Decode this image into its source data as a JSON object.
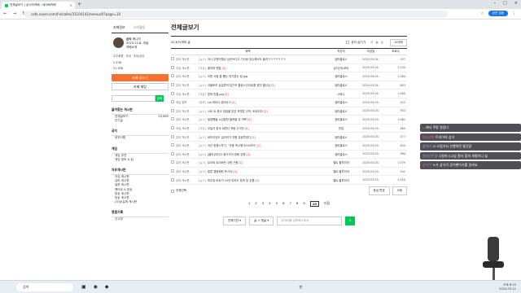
{
  "browser": {
    "tab_title": "전체글보기 | 삼식이카페 : 네이버카페",
    "url": "cafe.naver.com/f-e/cafes/31104141/menus/0?page=10",
    "profile_label": "완전 접음"
  },
  "sidebar": {
    "tabs": [
      "카페정보",
      "나의활동"
    ],
    "cafe_name": "삼식",
    "cafe_sub": "매니저",
    "since": "2023.12.8. 개설",
    "invite": "카페소개",
    "links": [
      "우수회원",
      "초대",
      "초대/공유"
    ],
    "stats": [
      "2,438",
      "51,638"
    ],
    "write_button": "카페 글쓰기",
    "join_button": "카페 채팅",
    "search_button": "검색",
    "sections": [
      {
        "title": "즐겨찾는 게시판",
        "items": [
          {
            "label": "전체글보기",
            "count": "20,869"
          },
          {
            "label": "인기글",
            "count": ""
          }
        ]
      },
      {
        "title": "공지",
        "items": [
          {
            "label": "공지사항",
            "count": ""
          }
        ]
      },
      {
        "title": "게임",
        "items": [
          {
            "label": "게임 추천",
            "count": ""
          },
          {
            "label": "게임 정보 & 팁",
            "count": ""
          }
        ]
      },
      {
        "title": "자유게시판",
        "items": [
          {
            "label": "자유 게시판",
            "count": ""
          },
          {
            "label": "유머 게시판",
            "count": ""
          },
          {
            "label": "질문 게시판",
            "count": ""
          },
          {
            "label": "팬아트 & 방송",
            "count": ""
          },
          {
            "label": "방송 게시판",
            "count": ""
          },
          {
            "label": "방송 게시판",
            "count": ""
          },
          {
            "label": "(오삼)길게 게시판",
            "count": ""
          }
        ]
      },
      {
        "title": "랭겜기록",
        "items": [
          {
            "label": "신고방",
            "count": ""
          }
        ]
      }
    ]
  },
  "main": {
    "title": "전체글보기",
    "count": "20,675개의 글",
    "notice_hide": "공지 숨기기",
    "per_page": "15개씩",
    "headers": [
      "제목",
      "작성자",
      "작성일",
      "조회수"
    ],
    "rows": [
      {
        "cat": "쥬아 게시판",
        "prefix": "[뉴스]",
        "title": "아니 뚜렌이형님 삼큰쓰디고 기사랑 장수해서도 올려ㅋㅋㅋㅋㅋㅋㅋ",
        "comments": "",
        "author": "엄마클로스",
        "date": "2025.03.04.",
        "views": "557"
      },
      {
        "cat": "자유 게시판",
        "prefix": "[자유]",
        "title": "배치파 맨탈",
        "comments": "[2]",
        "author": "남지인트포터",
        "date": "2025.03.04.",
        "views": "2,234"
      },
      {
        "cat": "쥬아 게시판",
        "prefix": "[뉴스]",
        "title": "어떤 사람 좀 뽑는 여기겠는 링.jpg",
        "comments": "",
        "author": "엄마클로스",
        "date": "2025.03.04.",
        "views": "1,084"
      },
      {
        "cat": "쥬아 게시판",
        "prefix": "[뉴스]",
        "title": "괴물토리 삼분류의 당근커 힐링스킨리트를 정민 출신님",
        "comments": "[2]",
        "author": "엄마클로스",
        "date": "2025.03.04.",
        "views": "843"
      },
      {
        "cat": "자유 게시판",
        "prefix": "[자유]",
        "title": "방파 만통.jpg",
        "comments": "[2]",
        "author": "너와나",
        "date": "2025.03.04.",
        "views": "1,060"
      },
      {
        "cat": "게임 정보",
        "prefix": "[정보]",
        "title": "Lol 럭터너 끊어라고",
        "comments": "[2]",
        "author": "엄마클로스",
        "date": "2025.03.03.",
        "views": "422"
      },
      {
        "cat": "쥬아 게시판",
        "prefix": "[뉴스]",
        "title": "사르 트 휴교 밍컴을 받은 포맷픈 신작, 토르티아",
        "comments": "[2]",
        "author": "엄마클로스",
        "date": "2025.03.03.",
        "views": "553"
      },
      {
        "cat": "쥬아 게시판",
        "prefix": "[뉴스]",
        "title": "밀재했을 소심찾한 블렛을 것 격복",
        "comments": "[3]",
        "author": "엄마클로스",
        "date": "2025.03.03.",
        "views": "1,081"
      },
      {
        "cat": "자유 게시판",
        "prefix": "[자유]",
        "title": "오늘자 한국 재판난 격동 주석안",
        "comments": "[4]",
        "author": "빈집",
        "date": "2025.03.03.",
        "views": "680"
      },
      {
        "cat": "쥬아 게시판",
        "prefix": "[뉴스]",
        "title": "바초이당도 길리커가 차원 유링투졌다",
        "comments": "[1]",
        "author": "엄마클로스",
        "date": "2025.03.03.",
        "views": "477"
      },
      {
        "cat": "쥬아 게시판",
        "prefix": "[뉴스]",
        "title": "국산 한좋스투기, \"국좋 즉시행 50%모자\"",
        "comments": "[2]",
        "author": "엄마클로스",
        "date": "2025.03.03.",
        "views": "624"
      },
      {
        "cat": "쥬아 게시판",
        "prefix": "[뉴스]",
        "title": "[블라]라디다 중고지어 대회 성명",
        "comments": "[2]",
        "author": "엄마클로스",
        "date": "2025.03.03.",
        "views": "964"
      },
      {
        "cat": "쥬아 게시판",
        "prefix": "[뉴스]",
        "title": "트리외 트리바린 쿠팡 근원",
        "comments": "[1]",
        "author": "엘트 블루리아",
        "date": "2025.03.03.",
        "views": "1,079"
      },
      {
        "cat": "쥬아 게시판",
        "prefix": "[뉴스]",
        "title": "얼른 캠핑패류 포스터",
        "comments": "[2]",
        "author": "엘트 블루리아",
        "date": "2025.03.03.",
        "views": "441"
      },
      {
        "cat": "쥬아 게시판",
        "prefix": "[뉴스]",
        "title": "퍼주워 바트가 10년 미하도 힘게 된 흐름",
        "comments": "[2]",
        "author": "엘트 블루리아",
        "date": "2025.03.03.",
        "views": "1,020"
      }
    ],
    "select_all": "전체선택",
    "btn_move": "등급 변경",
    "btn_delete": "삭제",
    "pages": [
      "1",
      "2",
      "3",
      "4",
      "5",
      "6",
      "7",
      "8",
      "9",
      "10"
    ],
    "current_page": "10",
    "next": "다음",
    "search_period": "전체기간",
    "search_field": "글 + 댓글",
    "search_placeholder": "검색어를 입력해주세요"
  },
  "chat": [
    {
      "user": "",
      "text": "...에서 쿠팡 알았다"
    },
    {
      "user": "미니리아",
      "text": "트리아의 삼식"
    },
    {
      "user": "삼식이",
      "text": "고 스팀가서 선행하면 될것같"
    },
    {
      "user": "멀티인돈을",
      "text": "나왕하시고삼 홈타 합의 개평이니 싫"
    },
    {
      "user": "삼식이",
      "text": "누가 삼식이 꽁이팬아가를 일까요"
    }
  ],
  "taskbar": {
    "search": "검색",
    "lang": "한",
    "time": "오후 6:22",
    "date": "2025-03-11"
  }
}
